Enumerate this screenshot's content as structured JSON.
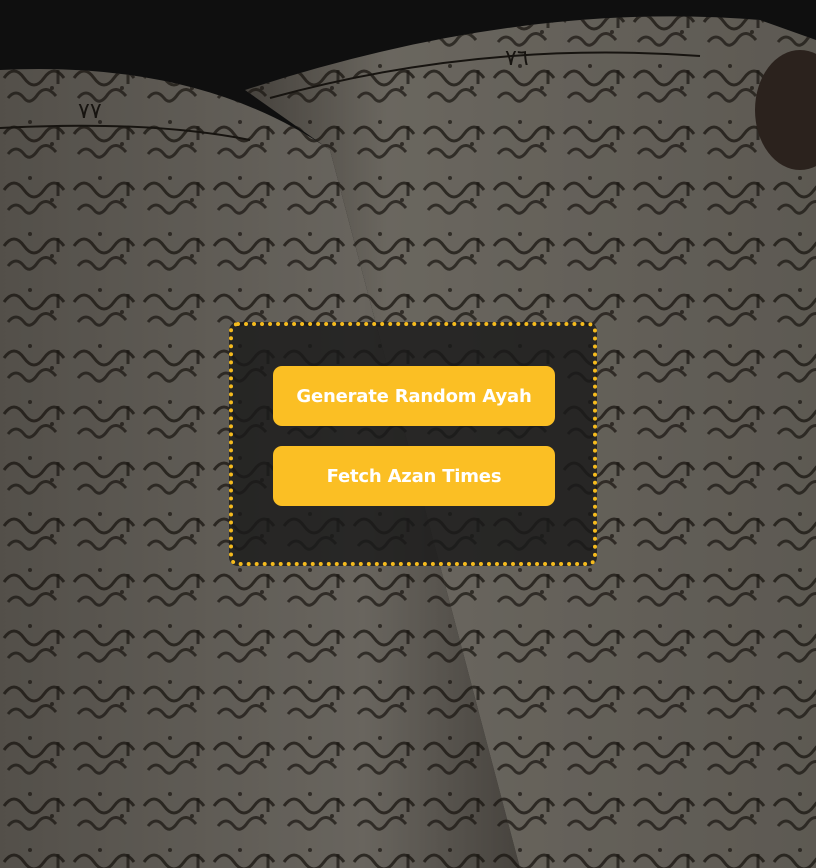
{
  "background": {
    "image_icon": "open-quran-book-photo",
    "page_numbers": [
      "٧٧",
      "٧٦"
    ],
    "colors": {
      "page": "#8a8479",
      "text": "#1f1b16",
      "backdrop": "#151515"
    }
  },
  "actions": {
    "generate_ayah_label": "Generate Random Ayah",
    "fetch_azan_label": "Fetch Azan Times"
  },
  "colors": {
    "accent": "#fbbf24",
    "panel_border": "#f5bb1e",
    "panel_bg": "#1a1a1a",
    "button_text": "#ffffff"
  }
}
